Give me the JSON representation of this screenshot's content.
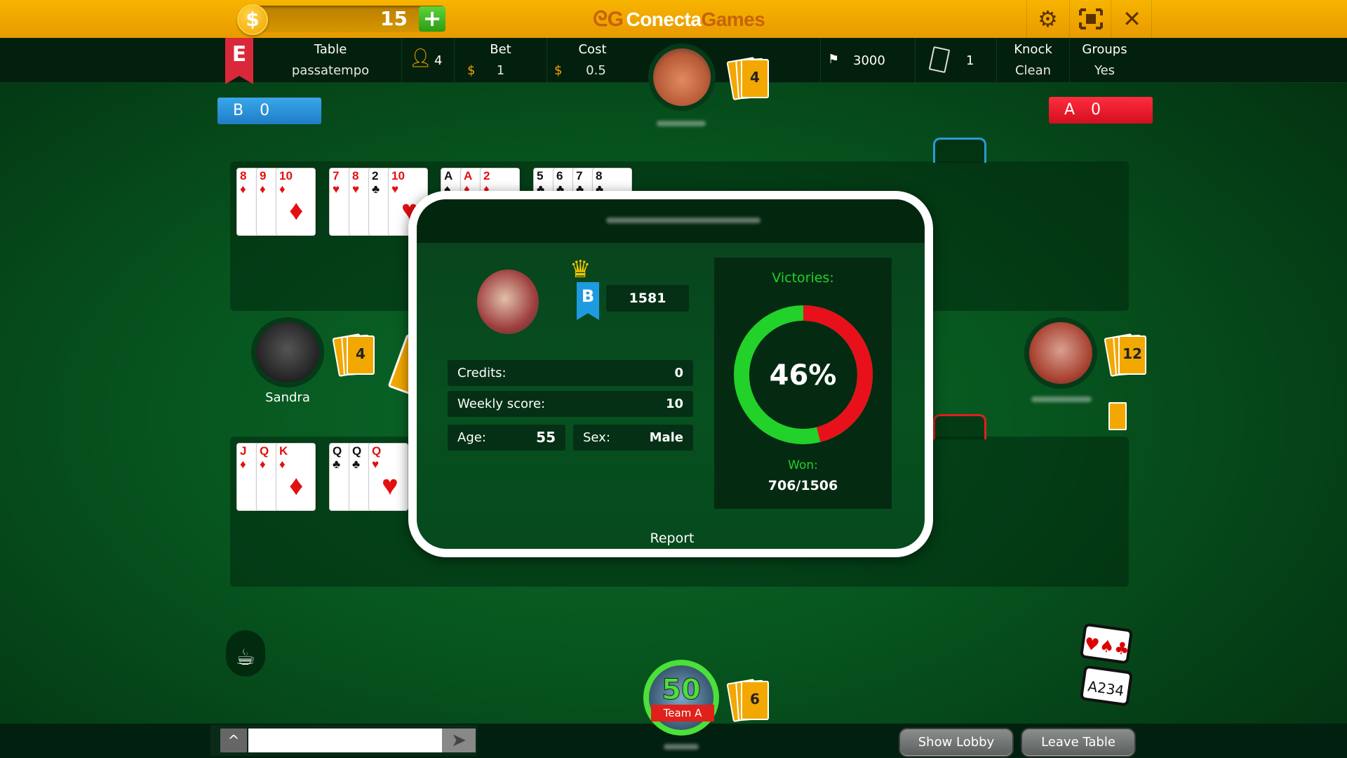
{
  "topbar": {
    "balance": "15",
    "coin_symbol": "$",
    "add_label": "+",
    "logo_first": "Conecta",
    "logo_second": "Games",
    "icons": [
      "gear-icon",
      "fullscreen-icon",
      "close-icon"
    ]
  },
  "infobar": {
    "team_letter": "E",
    "table_label": "Table",
    "table_value": "passatempo",
    "players": "4",
    "bet_label": "Bet",
    "bet_currency": "$",
    "bet_value": "1",
    "cost_label": "Cost",
    "cost_currency": "$",
    "cost_value": "0.5",
    "points": "3000",
    "discards": "1",
    "knock_label": "Knock",
    "knock_value": "Clean",
    "groups_label": "Groups",
    "groups_value": "Yes"
  },
  "scores": {
    "team_b": "B 0",
    "team_a": "A 0",
    "team_b_color": "#2a8fd6",
    "team_a_color": "#e8162a"
  },
  "players": {
    "top_cards": "4",
    "left_name": "Sandra",
    "left_cards": "4",
    "right_cards": "12",
    "self_cards": "6",
    "self_level": "50",
    "self_team": "Team A"
  },
  "melds_top": [
    [
      {
        "r": "8",
        "s": "♦"
      },
      {
        "r": "9",
        "s": "♦"
      },
      {
        "r": "10",
        "s": "♦"
      }
    ],
    [
      {
        "r": "7",
        "s": "♥"
      },
      {
        "r": "8",
        "s": "♥"
      },
      {
        "r": "2",
        "s": "♣"
      },
      {
        "r": "10",
        "s": "♥"
      }
    ],
    [
      {
        "r": "A",
        "s": "♠"
      },
      {
        "r": "A",
        "s": "♦"
      },
      {
        "r": "2",
        "s": "♦"
      }
    ],
    [
      {
        "r": "5",
        "s": "♣"
      },
      {
        "r": "6",
        "s": "♣"
      },
      {
        "r": "7",
        "s": "♣"
      },
      {
        "r": "8",
        "s": "♣"
      }
    ]
  ],
  "melds_bottom": [
    [
      {
        "r": "J",
        "s": "♦"
      },
      {
        "r": "Q",
        "s": "♦"
      },
      {
        "r": "K",
        "s": "♦"
      }
    ],
    [
      {
        "r": "Q",
        "s": "♣"
      },
      {
        "r": "Q",
        "s": "♣"
      },
      {
        "r": "Q",
        "s": "♥"
      }
    ]
  ],
  "profile": {
    "rank_letter": "B",
    "rating": "1581",
    "credits_label": "Credits:",
    "credits": "0",
    "weekly_label": "Weekly score:",
    "weekly": "10",
    "age_label": "Age:",
    "age": "55",
    "sex_label": "Sex:",
    "sex": "Male",
    "victories_label": "Victories:",
    "win_percent": 46,
    "win_percent_text": "46%",
    "won_label": "Won:",
    "won": "706/1506",
    "report_label": "Report",
    "win_color": "#e8101a",
    "loss_color": "#22d12a"
  },
  "bottom": {
    "show_lobby": "Show Lobby",
    "leave_table": "Leave Table",
    "chat_value": ""
  }
}
